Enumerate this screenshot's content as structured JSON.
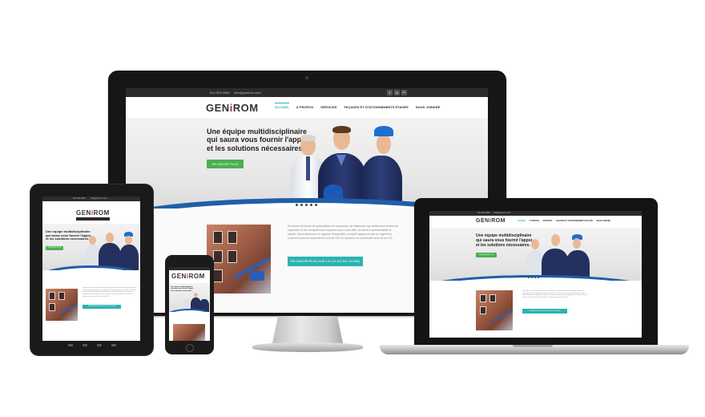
{
  "brand": {
    "logo_main": "GEN",
    "logo_i": "i",
    "logo_end": "ROM"
  },
  "topbar": {
    "phone": "514 523-3080",
    "email": "info@genirom.com"
  },
  "social": [
    "f",
    "in",
    "G+"
  ],
  "nav": {
    "items": [
      "ACCUEIL",
      "À PROPOS",
      "SERVICES",
      "FAÇADES ET STATIONNEMENTS ÉTAGÉS",
      "NOUS JOINDRE"
    ]
  },
  "hero": {
    "line1": "Une équipe multidisciplinaire",
    "line2": "qui saura vous fournir l'appui",
    "line3": "et les solutions nécessaires.",
    "cta": "EN SAVOIR PLUS"
  },
  "content": {
    "paragraph": "Genirom est formé de spécialistes en inspection de bâtiments qui détiennent toutes les capacités et les compétences requises pour vous offrir un service personnalisé et rapide. Nous détenons un rapport d'inspection complet approuvé par un ingénieur couvrant tous les aspects liés à la loi 122 du Québec en conformité avec la loi 122.",
    "button": "EN SAVOIR PLUS SUR LA LOI 122 DE LA RBQ"
  },
  "colors": {
    "accent_green": "#4caf50",
    "teal": "#2bb3b1",
    "logo_red": "#c8232c",
    "swoosh_blue": "#1f5fa8"
  }
}
